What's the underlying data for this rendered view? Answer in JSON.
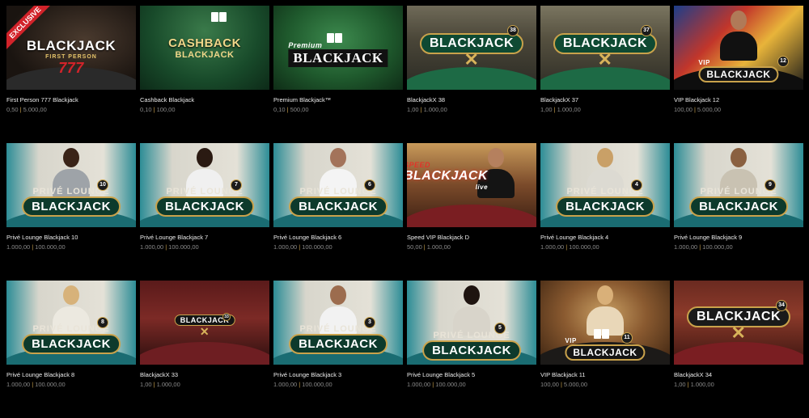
{
  "colors": {
    "background": "#000000",
    "title_text": "#ededed",
    "limit_text": "#8a8a8a",
    "separator": "#c9a24b",
    "exclusive_ribbon": "#d2232a"
  },
  "games": [
    {
      "title": "First Person 777 Blackjack",
      "min": "0,50",
      "max": "5.000,00",
      "badge": "EXCLUSIVE",
      "logo_line1": "BLACKJACK",
      "logo_line2": "FIRST PERSON",
      "logo_line3": "777"
    },
    {
      "title": "Cashback Blackjack",
      "min": "0,10",
      "max": "100,00",
      "logo_line1": "CASHBACK",
      "logo_line2": "BLACKJACK"
    },
    {
      "title": "Premium Blackjack™",
      "min": "0,10",
      "max": "500,00",
      "logo_line1": "Premium",
      "logo_line2": "BLACKJACK"
    },
    {
      "title": "BlackjackX 38",
      "min": "1,00",
      "max": "1.000,00",
      "logo_line1": "BLACKJACK",
      "table_no": "38"
    },
    {
      "title": "BlackjackX 37",
      "min": "1,00",
      "max": "1.000,00",
      "logo_line1": "BLACKJACK",
      "table_no": "37"
    },
    {
      "title": "VIP Blackjack 12",
      "min": "100,00",
      "max": "5.000,00",
      "logo_line1": "VIP",
      "logo_line2": "BLACKJACK",
      "table_no": "12"
    },
    {
      "title": "Privé Lounge Blackjack 10",
      "min": "1.000,00",
      "max": "100.000,00",
      "logo_line1": "PRIVÉ LOUNGE",
      "logo_line2": "BLACKJACK",
      "table_no": "10"
    },
    {
      "title": "Privé Lounge Blackjack 7",
      "min": "1.000,00",
      "max": "100.000,00",
      "logo_line1": "PRIVÉ LOUNGE",
      "logo_line2": "BLACKJACK",
      "table_no": "7"
    },
    {
      "title": "Privé Lounge Blackjack 6",
      "min": "1.000,00",
      "max": "100.000,00",
      "logo_line1": "PRIVÉ LOUNGE",
      "logo_line2": "BLACKJACK",
      "table_no": "6"
    },
    {
      "title": "Speed VIP Blackjack D",
      "min": "50,00",
      "max": "1.000,00",
      "logo_line1": "SPEED",
      "logo_line2": "BLACKJACK",
      "logo_line3": "live"
    },
    {
      "title": "Privé Lounge Blackjack 4",
      "min": "1.000,00",
      "max": "100.000,00",
      "logo_line1": "PRIVÉ LOUNGE",
      "logo_line2": "BLACKJACK",
      "table_no": "4"
    },
    {
      "title": "Privé Lounge Blackjack 9",
      "min": "1.000,00",
      "max": "100.000,00",
      "logo_line1": "PRIVÉ LOUNGE",
      "logo_line2": "BLACKJACK",
      "table_no": "9"
    },
    {
      "title": "Privé Lounge Blackjack 8",
      "min": "1.000,00",
      "max": "100.000,00",
      "logo_line1": "PRIVÉ LOUNGE",
      "logo_line2": "BLACKJACK",
      "table_no": "8"
    },
    {
      "title": "BlackjackX 33",
      "min": "1,00",
      "max": "1.000,00",
      "logo_line1": "BLACKJACK",
      "table_no": "33"
    },
    {
      "title": "Privé Lounge Blackjack 3",
      "min": "1.000,00",
      "max": "100.000,00",
      "logo_line1": "PRIVÉ LOUNGE",
      "logo_line2": "BLACKJACK",
      "table_no": "3"
    },
    {
      "title": "Privé Lounge Blackjack 5",
      "min": "1.000,00",
      "max": "100.000,00",
      "logo_line1": "PRIVÉ LOUNGE",
      "logo_line2": "BLACKJACK",
      "table_no": "5"
    },
    {
      "title": "VIP Blackjack 11",
      "min": "100,00",
      "max": "5.000,00",
      "logo_line1": "VIP",
      "logo_line2": "BLACKJACK",
      "table_no": "11"
    },
    {
      "title": "BlackjackX 34",
      "min": "1,00",
      "max": "1.000,00",
      "logo_line1": "BLACKJACK",
      "table_no": "34"
    }
  ],
  "separator_char": "|"
}
